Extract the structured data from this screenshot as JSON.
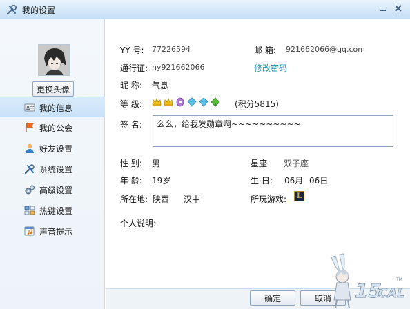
{
  "window": {
    "title": "我的设置"
  },
  "sidebar": {
    "change_avatar_label": "更换头像",
    "items": [
      {
        "label": "我的信息",
        "icon": "id-card-icon",
        "active": true
      },
      {
        "label": "我的公会",
        "icon": "flag-icon",
        "active": false
      },
      {
        "label": "好友设置",
        "icon": "user-icon",
        "active": false
      },
      {
        "label": "系统设置",
        "icon": "wrench-screwdriver-icon",
        "active": false
      },
      {
        "label": "高级设置",
        "icon": "gears-icon",
        "active": false
      },
      {
        "label": "热键设置",
        "icon": "keyboard-icon",
        "active": false
      },
      {
        "label": "声音提示",
        "icon": "sound-note-icon",
        "active": false
      }
    ]
  },
  "profile": {
    "yy_label": "YY  号:",
    "yy_value": "77226594",
    "email_label": "邮  箱:",
    "email_value": "921662066@qq.com",
    "passport_label": "通行证:",
    "passport_value": "hy921662066",
    "change_password": "修改密码",
    "nickname_label": "昵  称:",
    "nickname_value": "气息",
    "level_label": "等  级:",
    "level_icons": [
      "crown-icon",
      "crown-icon",
      "purple-badge-icon",
      "blue-diamond-icon",
      "blue-diamond-icon",
      "green-leaf-icon"
    ],
    "score_text": "(积分5815)",
    "signature_label": "签  名:",
    "signature_value": "么么，给我发勋章啊~~~~~~~~~~",
    "gender_label": "性  别:",
    "gender_value": "男",
    "zodiac_label": "星座",
    "zodiac_value": "双子座",
    "age_label": "年  龄:",
    "age_value": "19岁",
    "birthday_label": "生  日:",
    "birthday_month": "06月",
    "birthday_day": "06日",
    "location_label": "所在地:",
    "location_province": "陕西",
    "location_city": "汉中",
    "games_label": "所玩游戏:",
    "games_icon_letter": "L",
    "intro_label": "个人说明:"
  },
  "footer": {
    "ok_label": "确定",
    "cancel_label": "取消"
  },
  "colors": {
    "accent_link": "#2a8fb7",
    "title_gradient": "#d3e7f8",
    "active_nav": "#c9e1f7"
  }
}
